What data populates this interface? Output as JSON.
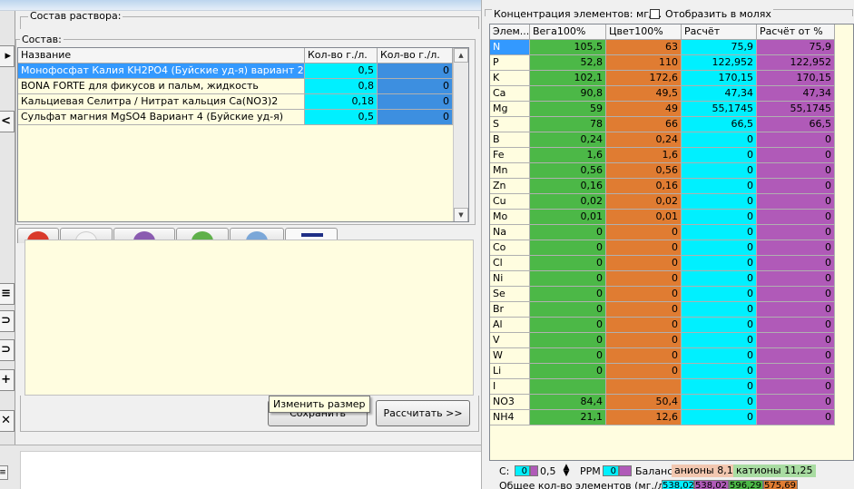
{
  "solution_panel": {
    "title": "Состав раствора:"
  },
  "composition": {
    "title": "Состав:",
    "columns": [
      "Название",
      "Кол-во г./л.",
      "Кол-во г./л."
    ],
    "rows": [
      {
        "name": "Монофосфат Калия KH2PO4 (Буйские уд-я) вариант 2",
        "qty": "0,5",
        "qty2": "0",
        "selected": true
      },
      {
        "name": "BONA FORTE для фикусов и пальм, жидкость",
        "qty": "0,8",
        "qty2": "0"
      },
      {
        "name": "Кальциевая Селитра / Нитрат кальция Ca(NO3)2",
        "qty": "0,18",
        "qty2": "0"
      },
      {
        "name": "Сульфат магния MgSO4 Вариант 4 (Буйские уд-я)",
        "qty": "0,5",
        "qty2": "0"
      }
    ]
  },
  "buttons": {
    "save": "Сохранить",
    "calculate": "Рассчитать >>"
  },
  "tooltip": "Изменить размер",
  "concentration": {
    "title": "Концентрация элементов: мг/л.",
    "moles_checkbox_label": "Отобразить в молях",
    "moles_checked": false,
    "columns": [
      "Элем...",
      "Вега100%",
      "Цвет100%",
      "Расчёт",
      "Расчёт от %"
    ],
    "rows": [
      {
        "el": "N",
        "a": "105,5",
        "b": "63",
        "c": "75,9",
        "d": "75,9"
      },
      {
        "el": "P",
        "a": "52,8",
        "b": "110",
        "c": "122,952",
        "d": "122,952"
      },
      {
        "el": "K",
        "a": "102,1",
        "b": "172,6",
        "c": "170,15",
        "d": "170,15"
      },
      {
        "el": "Ca",
        "a": "90,8",
        "b": "49,5",
        "c": "47,34",
        "d": "47,34"
      },
      {
        "el": "Mg",
        "a": "59",
        "b": "49",
        "c": "55,1745",
        "d": "55,1745"
      },
      {
        "el": "S",
        "a": "78",
        "b": "66",
        "c": "66,5",
        "d": "66,5"
      },
      {
        "el": "B",
        "a": "0,24",
        "b": "0,24",
        "c": "0",
        "d": "0"
      },
      {
        "el": "Fe",
        "a": "1,6",
        "b": "1,6",
        "c": "0",
        "d": "0"
      },
      {
        "el": "Mn",
        "a": "0,56",
        "b": "0,56",
        "c": "0",
        "d": "0"
      },
      {
        "el": "Zn",
        "a": "0,16",
        "b": "0,16",
        "c": "0",
        "d": "0"
      },
      {
        "el": "Cu",
        "a": "0,02",
        "b": "0,02",
        "c": "0",
        "d": "0"
      },
      {
        "el": "Mo",
        "a": "0,01",
        "b": "0,01",
        "c": "0",
        "d": "0"
      },
      {
        "el": "Na",
        "a": "0",
        "b": "0",
        "c": "0",
        "d": "0"
      },
      {
        "el": "Co",
        "a": "0",
        "b": "0",
        "c": "0",
        "d": "0"
      },
      {
        "el": "Cl",
        "a": "0",
        "b": "0",
        "c": "0",
        "d": "0"
      },
      {
        "el": "Ni",
        "a": "0",
        "b": "0",
        "c": "0",
        "d": "0"
      },
      {
        "el": "Se",
        "a": "0",
        "b": "0",
        "c": "0",
        "d": "0"
      },
      {
        "el": "Br",
        "a": "0",
        "b": "0",
        "c": "0",
        "d": "0"
      },
      {
        "el": "Al",
        "a": "0",
        "b": "0",
        "c": "0",
        "d": "0"
      },
      {
        "el": "V",
        "a": "0",
        "b": "0",
        "c": "0",
        "d": "0"
      },
      {
        "el": "W",
        "a": "0",
        "b": "0",
        "c": "0",
        "d": "0"
      },
      {
        "el": "Li",
        "a": "0",
        "b": "0",
        "c": "0",
        "d": "0"
      },
      {
        "el": "I",
        "a": "",
        "b": "",
        "c": "0",
        "d": "0"
      },
      {
        "el": "NO3",
        "a": "84,4",
        "b": "50,4",
        "c": "0",
        "d": "0"
      },
      {
        "el": "NH4",
        "a": "21,1",
        "b": "12,6",
        "c": "0",
        "d": "0"
      }
    ]
  },
  "status": {
    "c_label": "C:",
    "c_val1": "0",
    "c_val2": "0,5",
    "ppm_label": "PPM",
    "ppm_val": "0",
    "balance_label": "Баланс:",
    "anions_label": "анионы",
    "anions_val": "8,12",
    "cations_label": "катионы",
    "cations_val": "11,25",
    "total_label": "Общее кол-во элементов (мг./л.):",
    "total_vals": [
      "538,02",
      "538,02",
      "596,29",
      "575,69"
    ]
  },
  "colors": {
    "selected": "#3399ff",
    "cyan": "#00f0ff",
    "blue": "#3d8fe0",
    "green": "#4cb847",
    "orange": "#e07c32",
    "purple": "#b05ab8",
    "cream": "#fffde0"
  }
}
